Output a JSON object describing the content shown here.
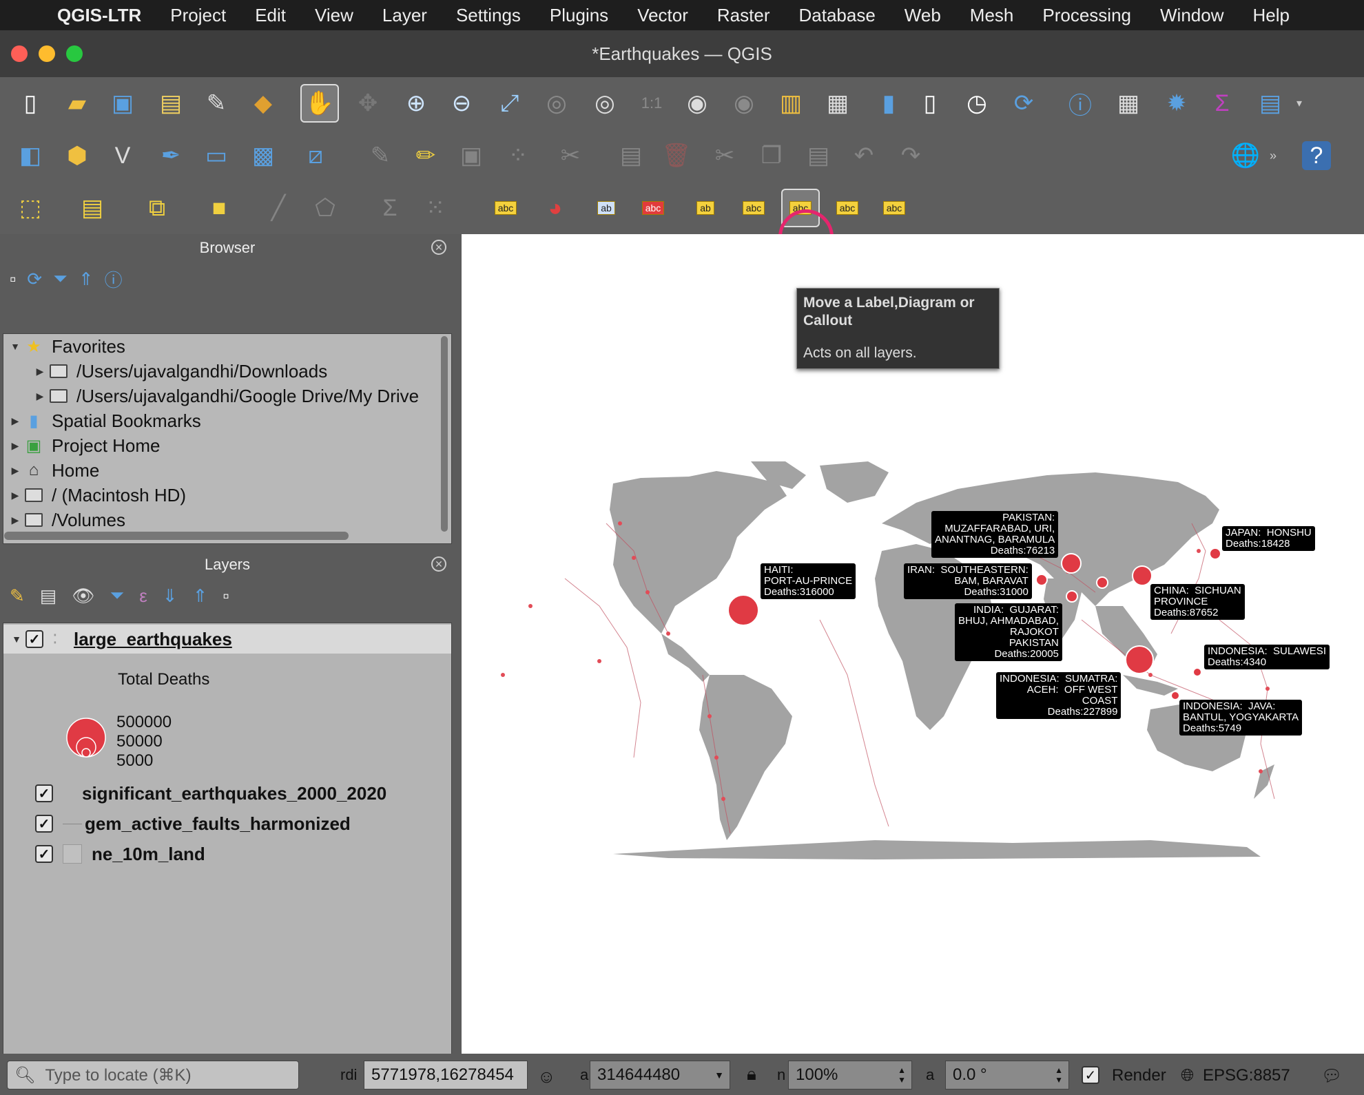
{
  "menubar": {
    "app": "QGIS-LTR",
    "items": [
      "Project",
      "Edit",
      "View",
      "Layer",
      "Settings",
      "Plugins",
      "Vector",
      "Raster",
      "Database",
      "Web",
      "Mesh",
      "Processing",
      "Window",
      "Help"
    ]
  },
  "window": {
    "title": "*Earthquakes — QGIS"
  },
  "tooltip": {
    "title": "Move a Label,Diagram or Callout",
    "desc": "Acts on all layers."
  },
  "toolbar": {
    "abc": "abc",
    "ab": "ab"
  },
  "browser": {
    "title": "Browser",
    "items": [
      {
        "label": "Favorites",
        "icon": "star-icon"
      },
      {
        "label": "/Users/ujavalgandhi/Downloads",
        "icon": "folder-icon"
      },
      {
        "label": "/Users/ujavalgandhi/Google Drive/My Drive",
        "icon": "folder-icon"
      },
      {
        "label": "Spatial Bookmarks",
        "icon": "bookmark-icon"
      },
      {
        "label": "Project Home",
        "icon": "project-home-icon"
      },
      {
        "label": "Home",
        "icon": "home-icon"
      },
      {
        "label": "/ (Macintosh HD)",
        "icon": "folder-icon"
      },
      {
        "label": "/Volumes",
        "icon": "folder-icon"
      }
    ]
  },
  "layers": {
    "title": "Layers",
    "items": [
      {
        "label": "large_earthquakes",
        "checked": true
      },
      {
        "label": "significant_earthquakes_2000_2020",
        "checked": true
      },
      {
        "label": "gem_active_faults_harmonized",
        "checked": true
      },
      {
        "label": "ne_10m_land",
        "checked": true
      }
    ],
    "legend": {
      "title": "Total Deaths",
      "values": [
        "500000",
        "50000",
        "5000"
      ]
    }
  },
  "map": {
    "labels": [
      {
        "text": "PAKISTAN:\nMUZAFFARABAD, URI,\nANANTNAG, BARAMULA\nDeaths:76213"
      },
      {
        "text": "JAPAN:  HONSHU\nDeaths:18428"
      },
      {
        "text": "HAITI:\nPORT-AU-PRINCE\nDeaths:316000"
      },
      {
        "text": "IRAN:  SOUTHEASTERN:\nBAM, BARAVAT\nDeaths:31000"
      },
      {
        "text": "CHINA:  SICHUAN\nPROVINCE\nDeaths:87652"
      },
      {
        "text": "INDIA:  GUJARAT:\nBHUJ, AHMADABAD,\nRAJOKOT\nPAKISTAN\nDeaths:20005"
      },
      {
        "text": "INDONESIA:  SULAWESI\nDeaths:4340"
      },
      {
        "text": "INDONESIA:  SUMATRA:\nACEH:  OFF WEST\nCOAST\nDeaths:227899"
      },
      {
        "text": "INDONESIA:  JAVA:\nBANTUL, YOGYAKARTA\nDeaths:5749"
      }
    ]
  },
  "status": {
    "locate_placeholder": "Type to locate (⌘K)",
    "coord_label": "rdi",
    "coord": "5771978,16278454",
    "scale_label": "a",
    "scale": "314644480",
    "mag_label": "n",
    "magnifier": "100%",
    "rot_label": "a",
    "rotation": "0.0 °",
    "render": "Render",
    "crs": "EPSG:8857"
  }
}
